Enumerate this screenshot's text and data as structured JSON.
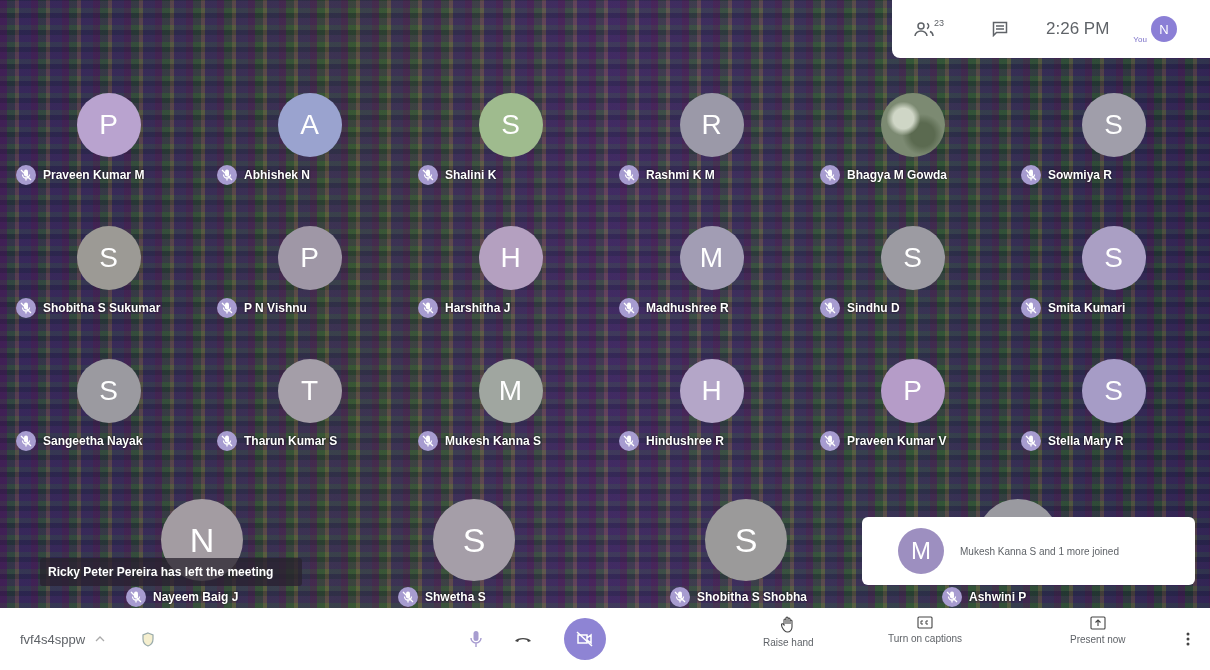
{
  "top_panel": {
    "participant_count": "23",
    "time": "2:26 PM",
    "self_label": "You",
    "self_initial": "N"
  },
  "participants": [
    {
      "kind": "letter",
      "initial": "P",
      "name": "Praveen Kumar M",
      "color": "#b9a3cf"
    },
    {
      "kind": "letter",
      "initial": "A",
      "name": "Abhishek N",
      "color": "#9aa3cf"
    },
    {
      "kind": "letter",
      "initial": "S",
      "name": "Shalini K",
      "color": "#9fbb8e"
    },
    {
      "kind": "letter",
      "initial": "R",
      "name": "Rashmi K M",
      "color": "#9b99a8"
    },
    {
      "kind": "photo",
      "name": "Bhagya M Gowda",
      "color": "#7c8a72"
    },
    {
      "kind": "letter",
      "initial": "S",
      "name": "Sowmiya R",
      "color": "#a09eaa"
    },
    {
      "kind": "letter",
      "initial": "S",
      "name": "Shobitha S Sukumar",
      "color": "#9c9a95"
    },
    {
      "kind": "letter",
      "initial": "P",
      "name": "P N Vishnu",
      "color": "#9f97a6"
    },
    {
      "kind": "letter",
      "initial": "H",
      "name": "Harshitha J",
      "color": "#b4a0c0"
    },
    {
      "kind": "letter",
      "initial": "M",
      "name": "Madhushree R",
      "color": "#a29db4"
    },
    {
      "kind": "letter",
      "initial": "S",
      "name": "Sindhu D",
      "color": "#9c9ba2"
    },
    {
      "kind": "letter",
      "initial": "S",
      "name": "Smita Kumari",
      "color": "#aa9fc4"
    },
    {
      "kind": "letter",
      "initial": "S",
      "name": "Sangeetha Nayak",
      "color": "#9b9aa0"
    },
    {
      "kind": "letter",
      "initial": "T",
      "name": "Tharun Kumar S",
      "color": "#a49ea8"
    },
    {
      "kind": "letter",
      "initial": "M",
      "name": "Mukesh Kanna S",
      "color": "#a0a6a0"
    },
    {
      "kind": "letter",
      "initial": "H",
      "name": "Hindushree R",
      "color": "#b4a6c8"
    },
    {
      "kind": "letter",
      "initial": "P",
      "name": "Praveen Kumar V",
      "color": "#b59cc8"
    },
    {
      "kind": "letter",
      "initial": "S",
      "name": "Stella Mary R",
      "color": "#a69cc6"
    }
  ],
  "featured_participants": [
    {
      "initial": "N",
      "name": "Nayeem Baig J",
      "color": "#a39ca2"
    },
    {
      "initial": "S",
      "name": "Shwetha S",
      "color": "#a59ea8"
    },
    {
      "initial": "S",
      "name": "Shobitha S Shobha",
      "color": "#9b9a9a"
    },
    {
      "name": "Ashwini P",
      "color": "#9a9aa0"
    }
  ],
  "toast": {
    "text": "Ricky Peter Pereira has left the meeting"
  },
  "join_notice": {
    "initial": "M",
    "text": "Mukesh Kanna S and 1 more joined"
  },
  "bottom_bar": {
    "meeting_code": "fvf4s4sppw",
    "camera_off": true,
    "actions": [
      {
        "kind": "hand",
        "label": "Raise hand"
      },
      {
        "kind": "captions",
        "label": "Turn on captions"
      },
      {
        "kind": "present",
        "label": "Present now"
      }
    ]
  }
}
